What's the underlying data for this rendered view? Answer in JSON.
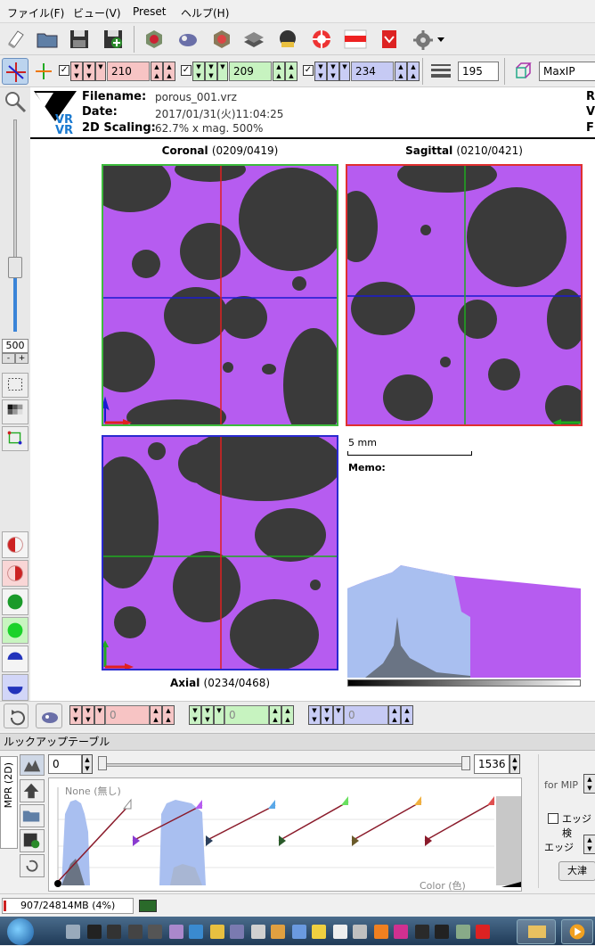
{
  "menu": [
    "ファイル(F)",
    "ビュー(V)",
    "Preset",
    "ヘルプ(H)"
  ],
  "toolbar2": {
    "x_value": "210",
    "y_value": "209",
    "z_value": "234",
    "thickness_value": "195",
    "render_mode": "MaxIP"
  },
  "info": {
    "filename_label": "Filename:",
    "filename_value": "porous_001.vrz",
    "date_label": "Date:",
    "date_value": "2017/01/31(火)11:04:25",
    "scaling_label": "2D Scaling:",
    "scaling_value": "62.7% x mag. 500%",
    "right_cut_1": "R",
    "right_cut_2": "V",
    "right_cut_3": "F"
  },
  "views": {
    "coronal_name": "Coronal",
    "coronal_index": "(0209/0419)",
    "sagittal_name": "Sagittal",
    "sagittal_index": "(0210/0421)",
    "axial_name": "Axial",
    "axial_index": "(0234/0468)"
  },
  "scale_label": "5 mm",
  "memo_label": "Memo:",
  "zoom_value": "500",
  "zoom_minus": "-",
  "zoom_plus": "+",
  "ctrl_row": {
    "v1": "0",
    "v2": "0",
    "v3": "0"
  },
  "lut": {
    "title": "ルックアップテーブル",
    "min_value": "0",
    "max_value": "1536",
    "side_tab": "MPR (2D)",
    "none_label": "None (無し)",
    "color_label": "Color (色)",
    "for_mip": "for MIP",
    "edge_check": "エッジ検",
    "edge_label": "エッジ",
    "right_button": "大津"
  },
  "status": {
    "memory": "907/24814MB (4%)"
  },
  "colors": {
    "purple": "#b65cf0",
    "coronal_border": "#3dbb3d",
    "sagittal_border": "#e03030",
    "axial_border": "#2a2ad0",
    "hist_blue": "#a9bff0"
  }
}
